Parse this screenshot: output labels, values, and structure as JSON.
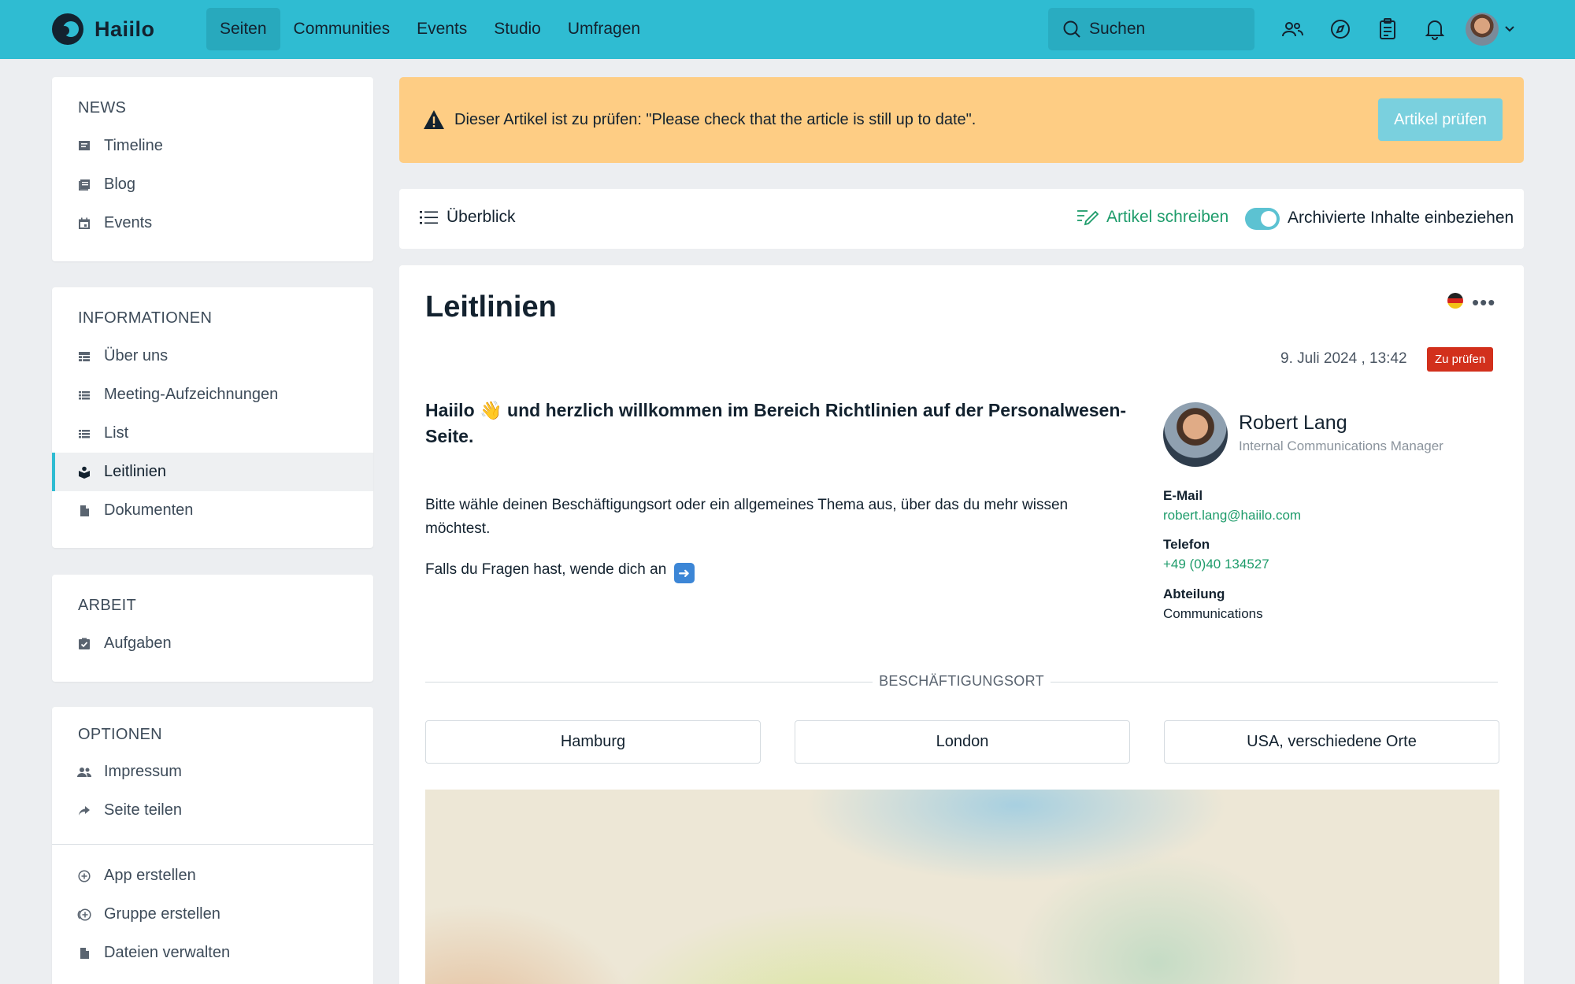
{
  "app": {
    "name": "Haiilo"
  },
  "nav": {
    "items": [
      {
        "label": "Seiten",
        "active": true
      },
      {
        "label": "Communities",
        "active": false
      },
      {
        "label": "Events",
        "active": false
      },
      {
        "label": "Studio",
        "active": false
      },
      {
        "label": "Umfragen",
        "active": false
      }
    ],
    "search_label": "Suchen",
    "icons": [
      "people-icon",
      "compass-icon",
      "clipboard-icon",
      "bell-icon"
    ]
  },
  "sidebar": {
    "sections": [
      {
        "heading": "NEWS",
        "items": [
          {
            "label": "Timeline",
            "icon": "timeline-icon"
          },
          {
            "label": "Blog",
            "icon": "blog-icon"
          },
          {
            "label": "Events",
            "icon": "calendar-icon"
          }
        ]
      },
      {
        "heading": "INFORMATIONEN",
        "items": [
          {
            "label": "Über uns",
            "icon": "table-icon"
          },
          {
            "label": "Meeting-Aufzeichnungen",
            "icon": "list-icon"
          },
          {
            "label": "List",
            "icon": "list-icon"
          },
          {
            "label": "Leitlinien",
            "icon": "book-icon",
            "active": true
          },
          {
            "label": "Dokumenten",
            "icon": "file-icon"
          }
        ]
      },
      {
        "heading": "ARBEIT",
        "items": [
          {
            "label": "Aufgaben",
            "icon": "task-icon"
          }
        ]
      },
      {
        "heading": "OPTIONEN",
        "items": [
          {
            "label": "Impressum",
            "icon": "people-icon"
          },
          {
            "label": "Seite teilen",
            "icon": "share-icon"
          },
          {
            "label": "App erstellen",
            "icon": "plus-circle-icon"
          },
          {
            "label": "Gruppe erstellen",
            "icon": "add-group-icon"
          },
          {
            "label": "Dateien verwalten",
            "icon": "file-icon"
          }
        ]
      }
    ]
  },
  "alert": {
    "text": "Dieser Artikel ist zu prüfen: \"Please check that the article is still up to date\".",
    "button": "Artikel prüfen",
    "color": "#fecd84"
  },
  "toolbar": {
    "overview": "Überblick",
    "write": "Artikel schreiben",
    "archive_toggle": "Archivierte Inhalte einbeziehen",
    "archive_toggle_on": true
  },
  "article": {
    "title": "Leitlinien",
    "date": "9. Juli 2024 , 13:42",
    "status_badge": "Zu prüfen",
    "lead": "Haiilo 👋 und herzlich willkommen im Bereich Richtlinien auf der Personalwesen-Seite.",
    "body_1": "Bitte wähle deinen Beschäftigungsort oder ein allgemeines Thema aus, über das du mehr wissen möchtest.",
    "body_2": "Falls du Fragen hast, wende dich an",
    "contact": {
      "name": "Robert Lang",
      "role": "Internal Communications Manager",
      "email_label": "E-Mail",
      "email": "robert.lang@haiilo.com",
      "phone_label": "Telefon",
      "phone": "+49 (0)40 134527",
      "dept_label": "Abteilung",
      "dept": "Communications"
    },
    "location_section": "BESCHÄFTIGUNGSORT",
    "locations": [
      "Hamburg",
      "London",
      "USA, verschiedene Orte"
    ]
  },
  "colors": {
    "brand": "#2fbcd2",
    "link": "#1e9c6b",
    "badge": "#d2301c"
  }
}
